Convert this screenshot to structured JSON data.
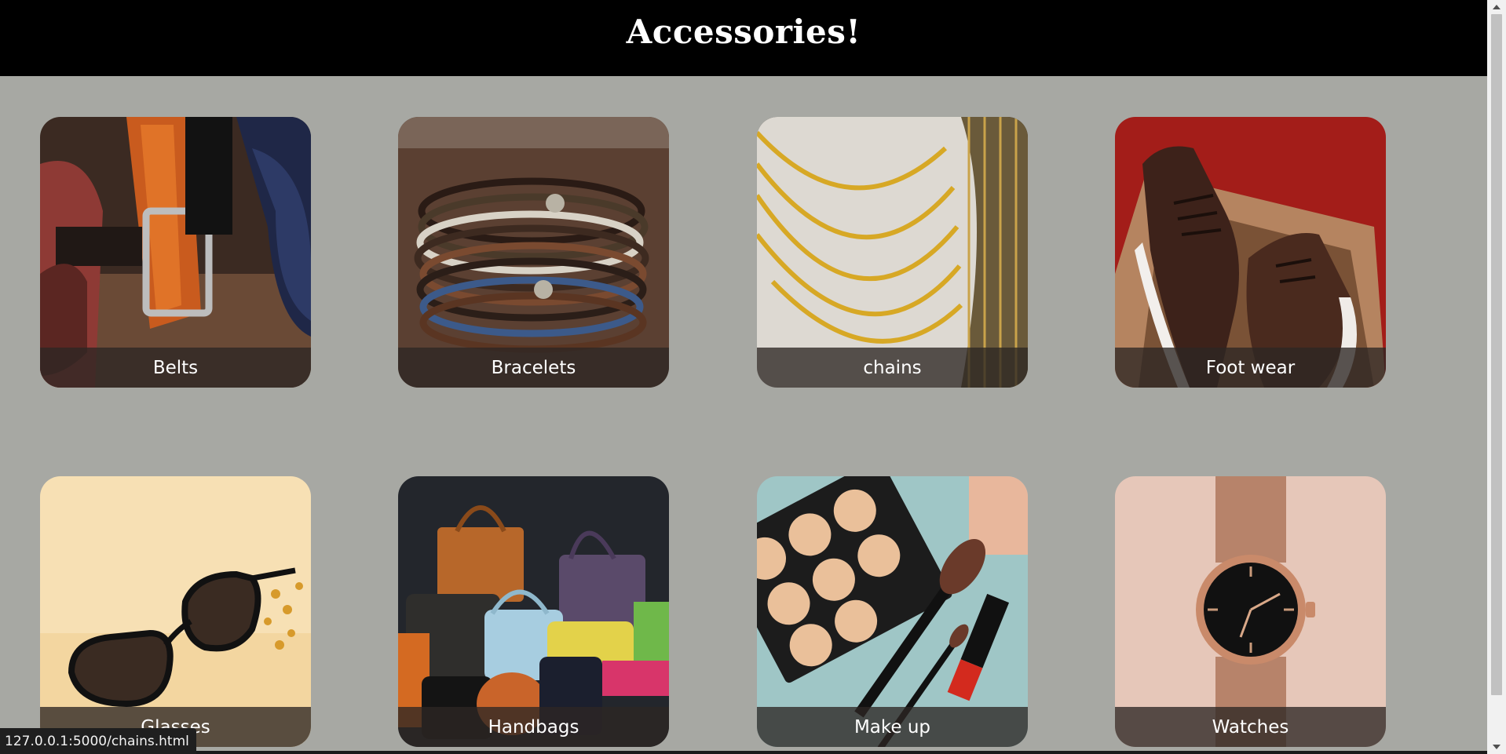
{
  "header": {
    "title": "Accessories!"
  },
  "categories": [
    {
      "label": "Belts"
    },
    {
      "label": "Bracelets"
    },
    {
      "label": "chains"
    },
    {
      "label": "Foot wear"
    },
    {
      "label": "Glasses"
    },
    {
      "label": "Handbags"
    },
    {
      "label": "Make up"
    },
    {
      "label": "Watches"
    }
  ],
  "status_bar": {
    "url": "127.0.0.1:5000/chains.html"
  }
}
